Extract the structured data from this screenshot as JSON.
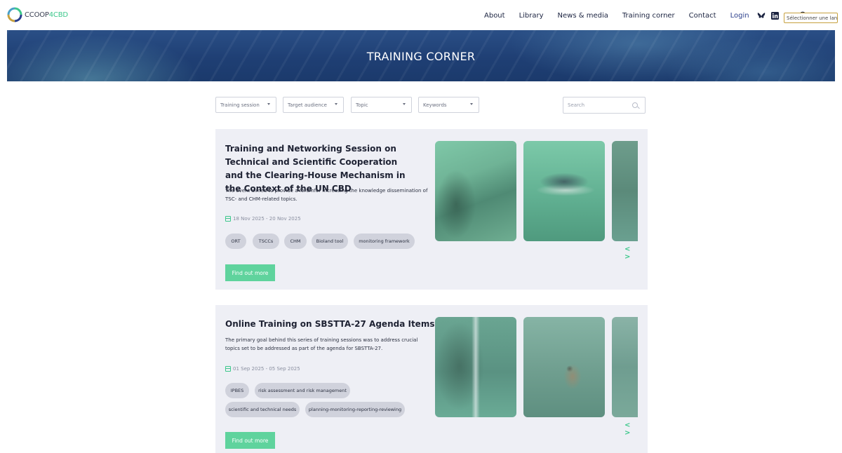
{
  "header": {
    "logo": {
      "text_main": "CCOOP",
      "text_accent": "4CBD"
    },
    "nav": [
      "About",
      "Library",
      "News & media",
      "Training corner",
      "Contact"
    ],
    "login": "Login",
    "language_select": "Sélectionner une langue",
    "icons": [
      "bluesky-icon",
      "linkedin-icon",
      "youtube-icon",
      "search-icon"
    ]
  },
  "banner": {
    "title": "TRAINING CORNER"
  },
  "filters": {
    "training_session": "Training session",
    "target_audience": "Target audience",
    "topic": "Topic",
    "keywords": "Keywords",
    "search_placeholder": "Search"
  },
  "cards": [
    {
      "title": "Training and Networking Session on Technical and Scientific Cooperation and the Clearing-House Mechanism in the Context of the UN CBD",
      "description": "The event aimed to provide a forumfor increasing the knowledge dissemination of TSC- and CHM-related topics.",
      "date": "18 Nov 2025 - 20 Nov 2025",
      "tags": [
        "ORT",
        "TSCCs",
        "CHM",
        "Bioland tool",
        "monitoring framework"
      ],
      "button": "Find out more",
      "arrows": "< >"
    },
    {
      "title": "Online Training on SBSTTA-27 Agenda Items",
      "description": "The primary goal behind this series of training sessions was to address crucial topics set to be addressed as part of the agenda for SBSTTA-27.",
      "date": "01 Sep 2025 - 05 Sep 2025",
      "tags": [
        "IPBES",
        "risk assessment and risk management",
        "scientific and technical needs",
        "planning-monitoring-reporting-reviewing"
      ],
      "button": "Find out more",
      "arrows": "< >"
    }
  ],
  "colors": {
    "accent": "#5fd39d",
    "nav_login": "#2b3f8c",
    "banner": "#1f3f74",
    "card_bg": "#eeeff5"
  }
}
